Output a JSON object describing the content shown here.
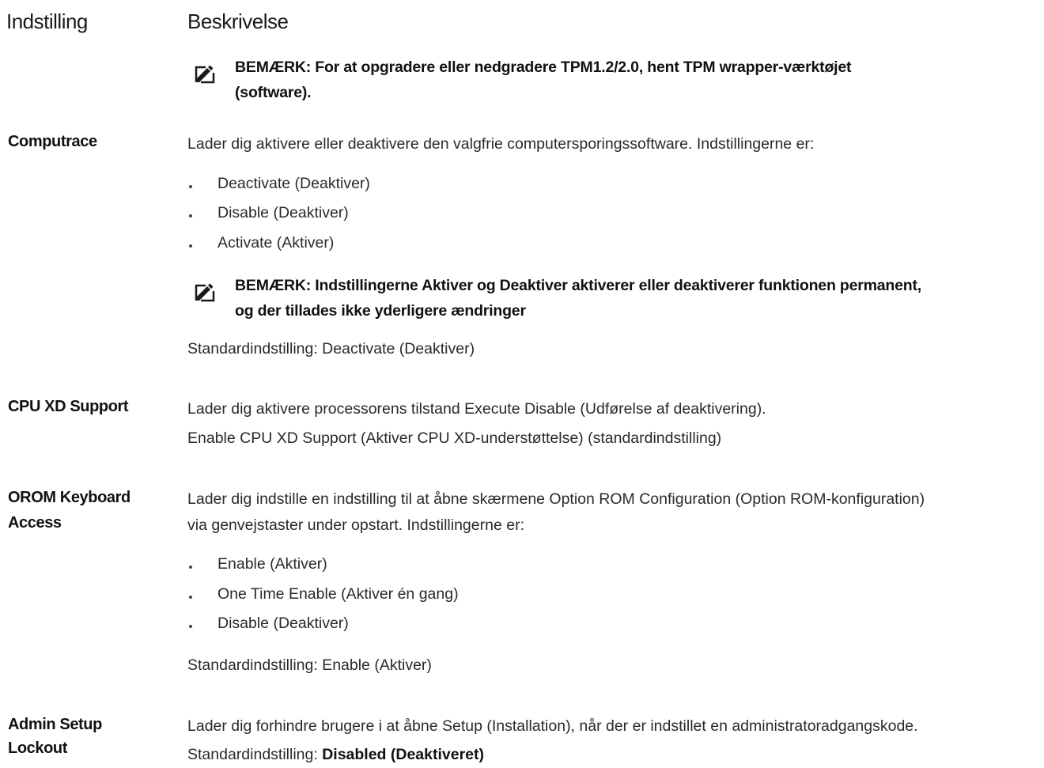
{
  "header": {
    "col1": "Indstilling",
    "col2": "Beskrivelse"
  },
  "note1": {
    "lines": [
      "BEMÆRK: For at opgradere eller nedgradere TPM1.2/2.0, hent TPM wrapper-værktøjet",
      "(software)."
    ]
  },
  "computrace": {
    "term": "Computrace",
    "desc": "Lader dig aktivere eller deaktivere den valgfrie computersporingssoftware. Indstillingerne er:",
    "options": [
      "Deactivate (Deaktiver)",
      "Disable (Deaktiver)",
      "Activate (Aktiver)"
    ],
    "note": [
      "BEMÆRK: Indstillingerne Aktiver og Deaktiver aktiverer eller deaktiverer funktionen permanent,",
      "og der tillades ikke yderligere ændringer"
    ],
    "default": "Standardindstilling: Deactivate (Deaktiver)"
  },
  "cpu_xd": {
    "term": "CPU XD Support",
    "desc": "Lader dig aktivere processorens tilstand Execute Disable (Udførelse af deaktivering).",
    "default": "Enable CPU XD Support (Aktiver CPU XD-understøttelse) (standardindstilling)"
  },
  "orom": {
    "term_lines": [
      "OROM Keyboard",
      "Access"
    ],
    "desc_lines": [
      "Lader dig indstille en indstilling til at åbne skærmene Option ROM Configuration (Option ROM-konfiguration)",
      "via genvejstaster under opstart. Indstillingerne er:"
    ],
    "options": [
      "Enable (Aktiver)",
      "One Time Enable (Aktiver én gang)",
      "Disable (Deaktiver)"
    ],
    "default": "Standardindstilling: Enable (Aktiver)"
  },
  "admin": {
    "term_lines": [
      "Admin Setup",
      "Lockout"
    ],
    "desc": "Lader dig forhindre brugere i at åbne Setup (Installation), når der er indstillet en administratoradgangskode.",
    "default_prefix": "Standardindstilling: ",
    "default_value": "Disabled (Deaktiveret)"
  }
}
